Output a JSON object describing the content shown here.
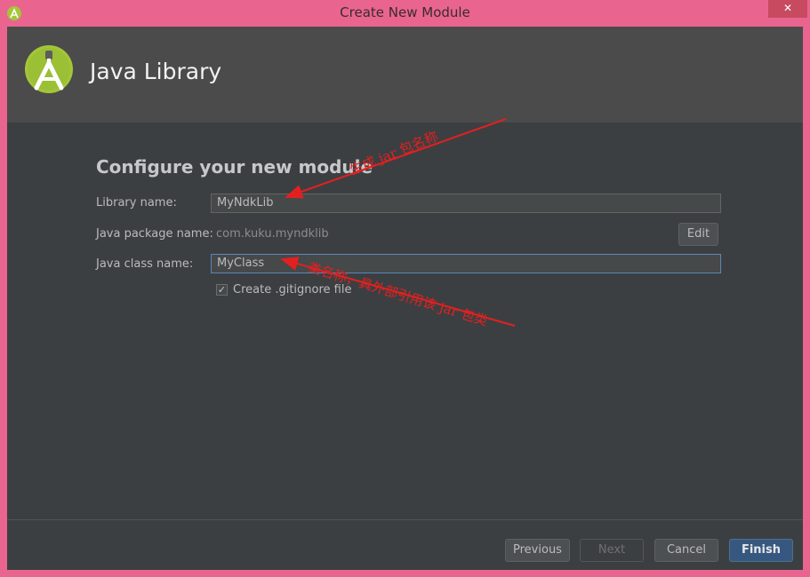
{
  "window": {
    "title": "Create New Module",
    "close_glyph": "✕"
  },
  "banner": {
    "title": "Java Library",
    "logo_icon": "android-studio-icon"
  },
  "form": {
    "heading": "Configure your new module",
    "library_name_label": "Library name:",
    "library_name_value": "MyNdkLib",
    "package_label": "Java package name:",
    "package_value": "com.kuku.myndklib",
    "edit_label": "Edit",
    "class_label": "Java class name:",
    "class_value": "MyClass",
    "gitignore_checked": true,
    "gitignore_label": "Create .gitignore file"
  },
  "annotations": {
    "jar_name_note": "生成 jar 包名称",
    "class_name_note": "类名称，具外部引用该 jar 包类"
  },
  "footer": {
    "previous_label": "Previous",
    "next_label": "Next",
    "cancel_label": "Cancel",
    "finish_label": "Finish"
  },
  "colors": {
    "window_frame": "#e9658f",
    "client_bg": "#3c3f41",
    "banner_bg": "#4b4b4b",
    "annotation_red": "#e32020",
    "android_green": "#a4c639"
  }
}
